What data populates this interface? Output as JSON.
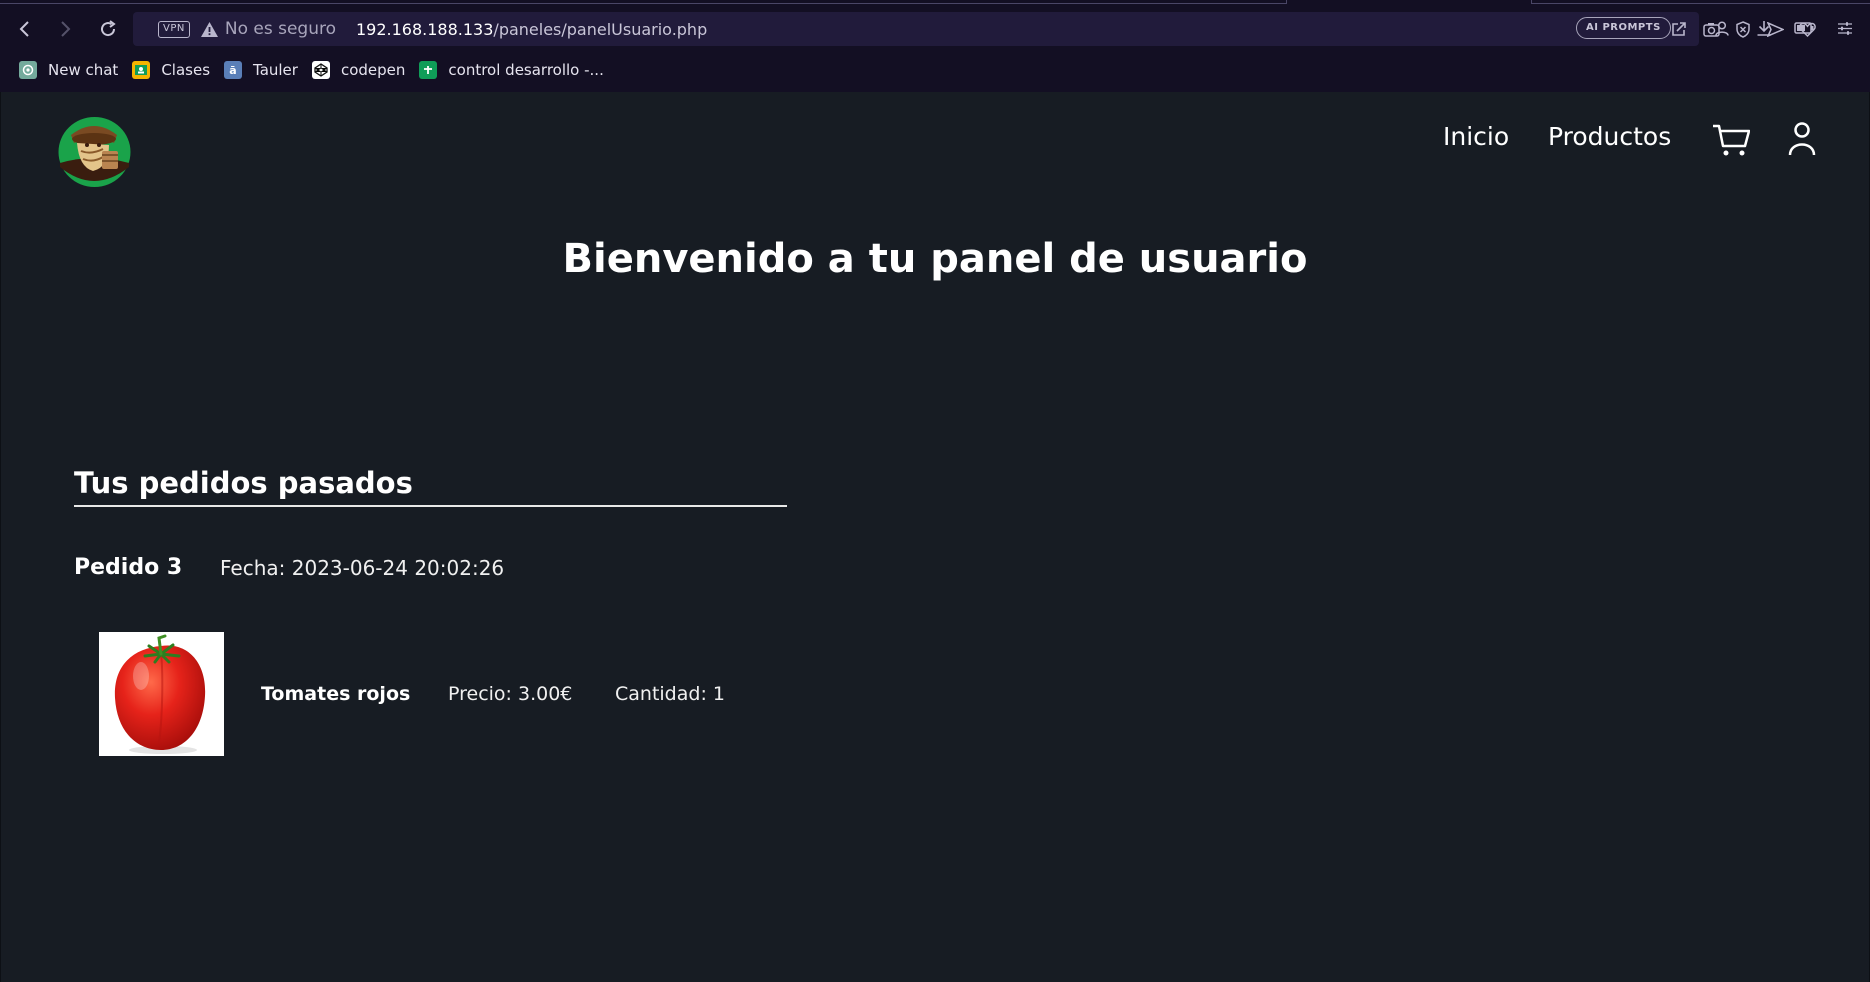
{
  "browser": {
    "vpn_label": "VPN",
    "security_text": "No es seguro",
    "url_host": "192.168.188.133",
    "url_path": "/paneles/panelUsuario.php",
    "ai_prompts_label": "AI PROMPTS",
    "bookmarks": [
      {
        "label": "New chat",
        "icon": "openai-icon",
        "color": "#74aa9c"
      },
      {
        "label": "Clases",
        "icon": "classroom-icon",
        "color": "#f4b400"
      },
      {
        "label": "Tauler",
        "icon": "tauler-icon",
        "color": "#5a7fb8"
      },
      {
        "label": "codepen",
        "icon": "codepen-icon",
        "color": "#ffffff"
      },
      {
        "label": "control desarrollo -...",
        "icon": "sheets-icon",
        "color": "#0f9d58"
      }
    ]
  },
  "site": {
    "nav": {
      "home": "Inicio",
      "products": "Productos"
    },
    "title": "Bienvenido a tu panel de usuario",
    "orders_section_title": "Tus pedidos pasados",
    "orders": [
      {
        "label": "Pedido 3",
        "date": "Fecha: 2023-06-24 20:02:26",
        "items": [
          {
            "name": "Tomates rojos",
            "price": "Precio: 3.00€",
            "quantity": "Cantidad: 1",
            "image": "tomato-image"
          }
        ]
      }
    ]
  },
  "colors": {
    "page_background": "#171c23",
    "chrome_background": "#130f23",
    "address_bar": "#211b3b",
    "logo_green": "#1aa34a"
  }
}
